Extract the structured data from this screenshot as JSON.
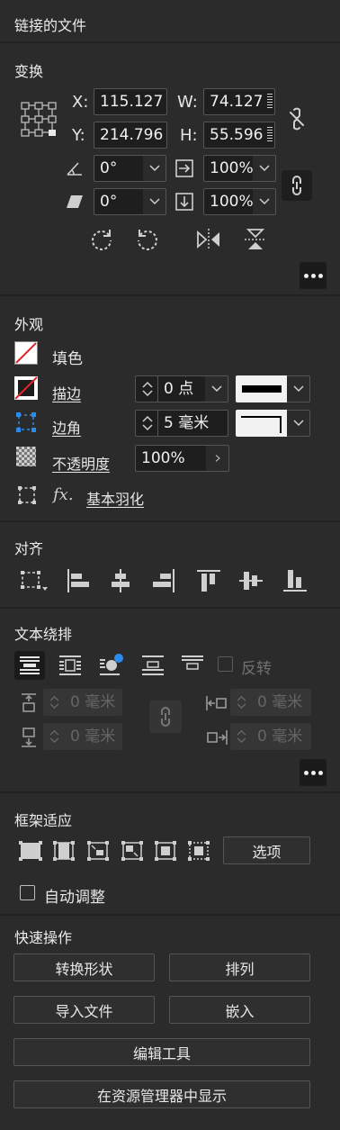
{
  "panel": {
    "linked_files": "链接的文件",
    "transform": {
      "title": "变换",
      "x_label": "X:",
      "x_value": "115.127",
      "w_label": "W:",
      "w_value": "74.127",
      "y_label": "Y:",
      "y_value": "214.796",
      "h_label": "H:",
      "h_value": "55.596",
      "rotate_value": "0°",
      "scale_x_value": "100%",
      "shear_value": "0°",
      "scale_y_value": "100%"
    },
    "appearance": {
      "title": "外观",
      "fill_label": "填色",
      "stroke_label": "描边",
      "stroke_weight": "0 点",
      "corner_label": "边角",
      "corner_value": "5 毫米",
      "opacity_label": "不透明度",
      "opacity_value": "100%",
      "fx_label": "fx.",
      "feather_label": "基本羽化"
    },
    "align": {
      "title": "对齐"
    },
    "text_wrap": {
      "title": "文本绕排",
      "invert_label": "反转",
      "top_offset": "0 毫米",
      "bottom_offset": "0 毫米",
      "left_offset": "0 毫米",
      "right_offset": "0 毫米"
    },
    "frame_fitting": {
      "title": "框架适应",
      "options_button": "选项",
      "auto_fit_label": "自动调整"
    },
    "quick_actions": {
      "title": "快速操作",
      "convert_shape": "转换形状",
      "arrange": "排列",
      "import_file": "导入文件",
      "embed": "嵌入",
      "edit_tools": "编辑工具",
      "show_in_explorer": "在资源管理器中显示"
    }
  },
  "colors": {
    "panel_bg": "#2b2b2b",
    "field_bg": "#1e1e1e",
    "accent_blue": "#2d8ceb",
    "none_red": "#e0262a"
  }
}
